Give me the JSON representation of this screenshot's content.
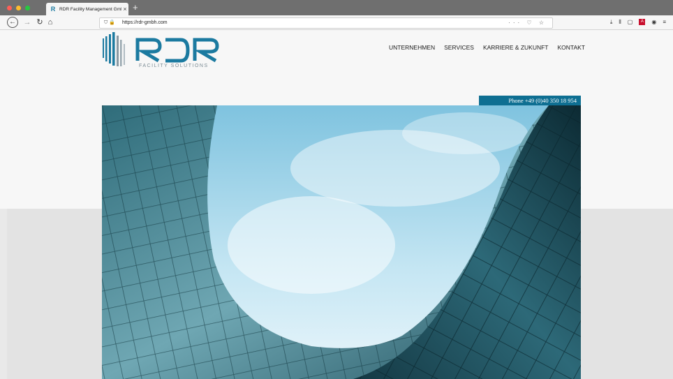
{
  "browser": {
    "tab_title": "RDR Facility Management GmbH",
    "tab_close": "×",
    "new_tab": "+",
    "url": "https://rdr-gmbh.com",
    "url_actions": "··· ♡ ☆",
    "window_colors": {
      "close": "#ff5f57",
      "minimize": "#febc2e",
      "zoom": "#28c840"
    }
  },
  "site": {
    "logo": {
      "wordmark": "RDR",
      "tagline": "FACILITY SOLUTIONS",
      "color": "#1b7aa0"
    },
    "nav": [
      "UNTERNEHMEN",
      "SERVICES",
      "KARRIERE & ZUKUNFT",
      "KONTAKT"
    ],
    "phone": "Phone +49 (0)40 350 18 954",
    "accent": "#0e6f92"
  },
  "icons": [
    "back-icon",
    "forward-icon",
    "reload-icon",
    "home-icon",
    "shield-icon",
    "lock-icon",
    "download-icon",
    "library-icon",
    "sidebar-icon",
    "pdf-icon",
    "account-icon",
    "menu-icon"
  ]
}
